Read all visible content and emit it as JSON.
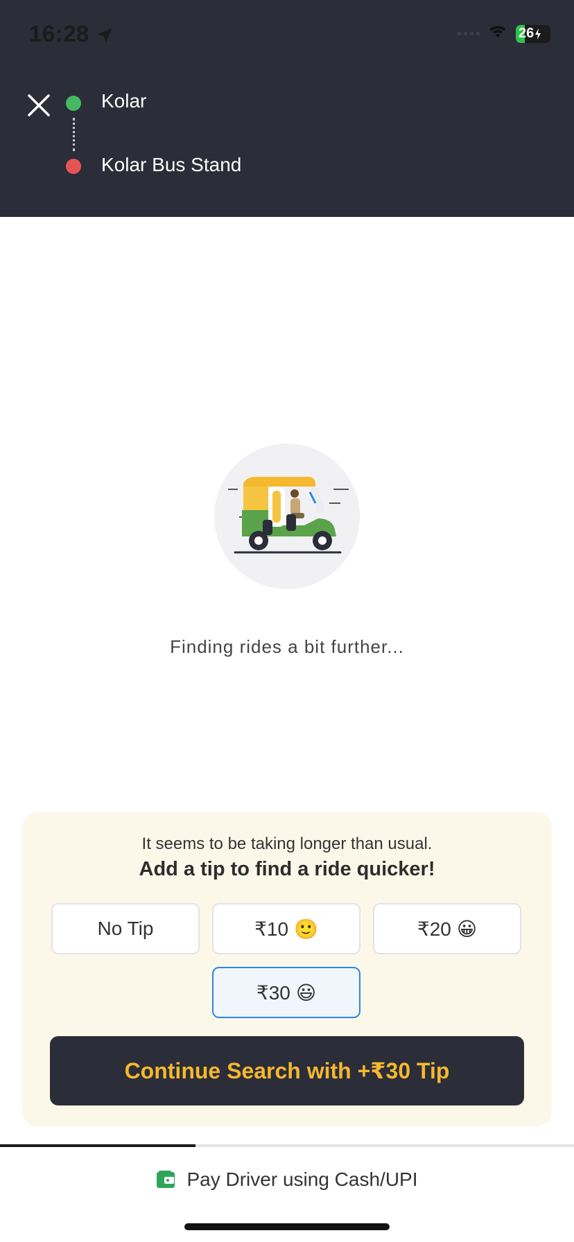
{
  "status_bar": {
    "time": "16:28",
    "battery": "26",
    "battery_level": 0.26
  },
  "route": {
    "origin": "Kolar",
    "destination": "Kolar Bus Stand"
  },
  "search": {
    "status_text": "Finding rides a bit further..."
  },
  "tip": {
    "message": "It seems to be taking longer than usual.",
    "headline": "Add a tip to find a ride quicker!",
    "options": [
      {
        "label": "No Tip",
        "emoji": ""
      },
      {
        "label": "₹10",
        "emoji": "🙂"
      },
      {
        "label": "₹20",
        "emoji": "😀"
      },
      {
        "label": "₹30",
        "emoji": "😃"
      }
    ],
    "selected_index": 3,
    "continue_label": "Continue Search with +₹30 Tip"
  },
  "progress": 0.34,
  "payment": {
    "label": "Pay Driver using Cash/UPI"
  },
  "colors": {
    "header_bg": "#2b2d38",
    "accent_yellow": "#f5b82e",
    "origin_green": "#46b863",
    "dest_red": "#e55454",
    "selected_blue": "#2a86e4"
  }
}
